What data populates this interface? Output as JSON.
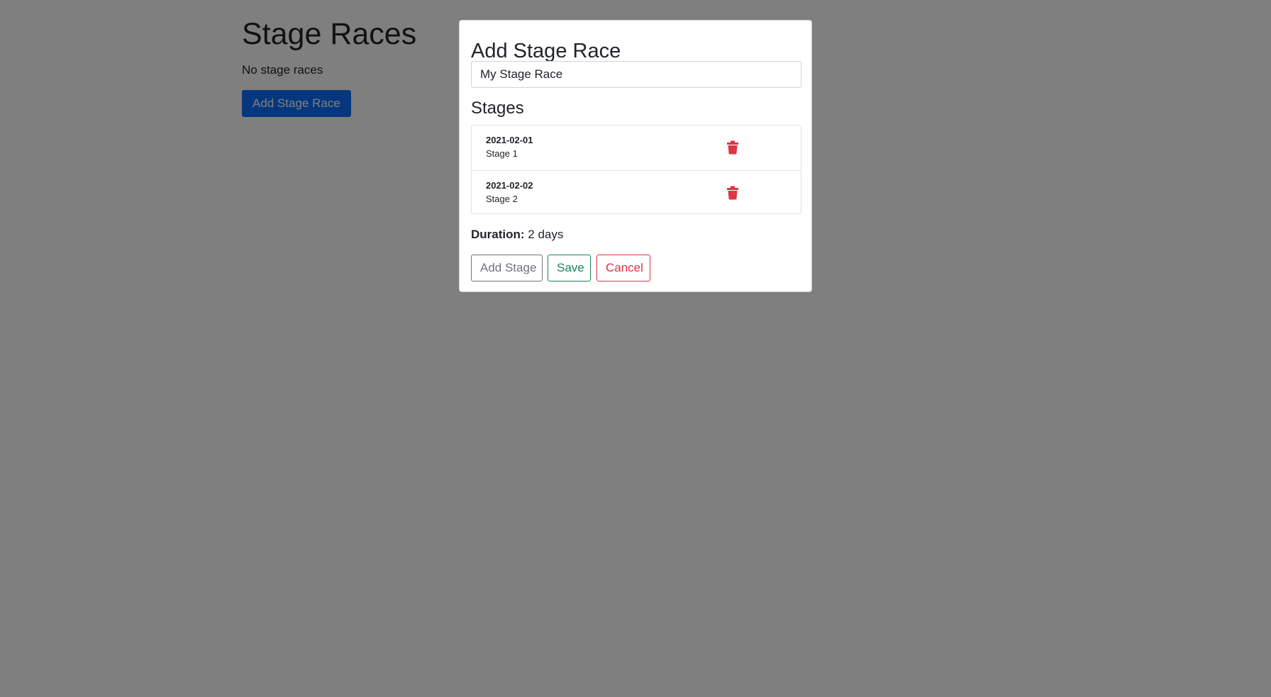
{
  "page": {
    "title": "Stage Races",
    "empty_message": "No stage races",
    "add_button_label": "Add Stage Race"
  },
  "modal": {
    "title": "Add Stage Race",
    "name_input": {
      "value": "My Stage Race",
      "placeholder": ""
    },
    "stages_heading": "Stages",
    "stages": [
      {
        "date": "2021-02-01",
        "name": "Stage 1",
        "delete_icon": "trash-icon"
      },
      {
        "date": "2021-02-02",
        "name": "Stage 2",
        "delete_icon": "trash-icon"
      }
    ],
    "duration": {
      "label": "Duration:",
      "value": "2 days"
    },
    "buttons": {
      "add_stage": "Add Stage",
      "save": "Save",
      "cancel": "Cancel"
    }
  },
  "colors": {
    "primary": "#0d6efd",
    "secondary": "#6c757d",
    "success": "#198754",
    "danger": "#dc3545",
    "backdrop": "rgba(0,0,0,0.5)"
  }
}
